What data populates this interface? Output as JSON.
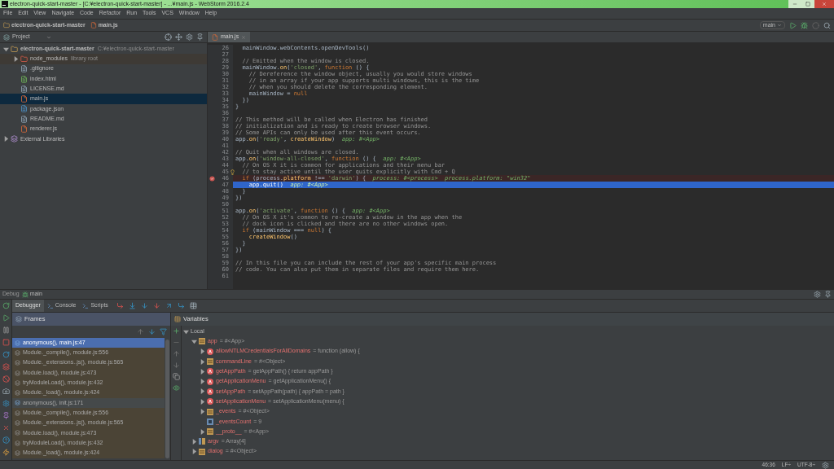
{
  "window": {
    "title": "electron-quick-start-master - [C:¥electron-quick-start-master] - ...¥main.js - WebStorm 2016.2.4"
  },
  "menu": [
    "File",
    "Edit",
    "View",
    "Navigate",
    "Code",
    "Refactor",
    "Run",
    "Tools",
    "VCS",
    "Window",
    "Help"
  ],
  "breadcrumbs": [
    "electron-quick-start-master",
    "main.js"
  ],
  "run_config": "main",
  "project": {
    "title": "Project",
    "tree": [
      {
        "name": "electron-quick-start-master",
        "hint": "C:¥electron-quick-start-master",
        "kind": "folder",
        "expanded": true,
        "selected": false,
        "children": [
          {
            "name": "node_modules",
            "hint": "library root",
            "kind": "library",
            "expanded": false,
            "selected": false
          },
          {
            "name": ".gitignore",
            "kind": "text",
            "selected": false
          },
          {
            "name": "index.html",
            "kind": "html",
            "selected": false
          },
          {
            "name": "LICENSE.md",
            "kind": "text",
            "selected": false
          },
          {
            "name": "main.js",
            "kind": "js",
            "selected": true
          },
          {
            "name": "package.json",
            "kind": "json",
            "selected": false
          },
          {
            "name": "README.md",
            "kind": "text",
            "selected": false
          },
          {
            "name": "renderer.js",
            "kind": "js",
            "selected": false
          }
        ]
      },
      {
        "name": "External Libraries",
        "kind": "external",
        "expanded": false,
        "selected": false
      }
    ]
  },
  "editor": {
    "tabs": [
      {
        "label": "main.js",
        "selected": true
      }
    ],
    "lines": [
      {
        "number": "26",
        "kind": "plain",
        "tokens": [
          {
            "text": "  mainWindow.webContents.openDevTools()",
            "kind": "plain"
          }
        ]
      },
      {
        "number": "27",
        "kind": "plain"
      },
      {
        "number": "28",
        "kind": "plain",
        "tokens": [
          {
            "text": "  // Emitted when the window is closed.",
            "kind": "comment"
          }
        ]
      },
      {
        "number": "29",
        "kind": "plain",
        "tokens": [
          {
            "text": "  mainWindow.",
            "kind": "plain"
          },
          {
            "text": "on",
            "kind": "method"
          },
          {
            "text": "(",
            "kind": "plain"
          },
          {
            "text": "'closed'",
            "kind": "string"
          },
          {
            "text": ", ",
            "kind": "plain"
          },
          {
            "text": "function",
            "kind": "keyword"
          },
          {
            "text": " () {",
            "kind": "plain"
          }
        ]
      },
      {
        "number": "30",
        "kind": "plain",
        "tokens": [
          {
            "text": "    // Dereference the window object, usually you would store windows",
            "kind": "comment"
          }
        ]
      },
      {
        "number": "31",
        "kind": "plain",
        "tokens": [
          {
            "text": "    // in an array if your app supports multi windows, this is the time",
            "kind": "comment"
          }
        ]
      },
      {
        "number": "32",
        "kind": "plain",
        "tokens": [
          {
            "text": "    // when you should delete the corresponding element.",
            "kind": "comment"
          }
        ]
      },
      {
        "number": "33",
        "kind": "plain",
        "tokens": [
          {
            "text": "    mainWindow = ",
            "kind": "plain"
          },
          {
            "text": "null",
            "kind": "keyword"
          }
        ]
      },
      {
        "number": "34",
        "kind": "plain",
        "tokens": [
          {
            "text": "  })",
            "kind": "plain"
          }
        ]
      },
      {
        "number": "35",
        "kind": "plain",
        "tokens": [
          {
            "text": "}",
            "kind": "plain"
          }
        ]
      },
      {
        "number": "36",
        "kind": "plain"
      },
      {
        "number": "37",
        "kind": "plain",
        "tokens": [
          {
            "text": "// This method will be called when Electron has finished",
            "kind": "comment"
          }
        ]
      },
      {
        "number": "38",
        "kind": "plain",
        "tokens": [
          {
            "text": "// initialization and is ready to create browser windows.",
            "kind": "comment"
          }
        ]
      },
      {
        "number": "39",
        "kind": "plain",
        "tokens": [
          {
            "text": "// Some APIs can only be used after this event occurs.",
            "kind": "comment"
          }
        ]
      },
      {
        "number": "40",
        "kind": "plain",
        "tokens": [
          {
            "text": "app.",
            "kind": "plain"
          },
          {
            "text": "on",
            "kind": "method"
          },
          {
            "text": "(",
            "kind": "plain"
          },
          {
            "text": "'ready'",
            "kind": "string"
          },
          {
            "text": ", ",
            "kind": "plain"
          },
          {
            "text": "createWindow",
            "kind": "method"
          },
          {
            "text": ")",
            "kind": "plain"
          },
          {
            "text": "  app: #<App>",
            "kind": "hint"
          }
        ]
      },
      {
        "number": "41",
        "kind": "plain"
      },
      {
        "number": "42",
        "kind": "plain",
        "tokens": [
          {
            "text": "// Quit when all windows are closed.",
            "kind": "comment"
          }
        ]
      },
      {
        "number": "43",
        "kind": "plain",
        "tokens": [
          {
            "text": "app.",
            "kind": "plain"
          },
          {
            "text": "on",
            "kind": "method"
          },
          {
            "text": "(",
            "kind": "plain"
          },
          {
            "text": "'window-all-closed'",
            "kind": "string"
          },
          {
            "text": ", ",
            "kind": "plain"
          },
          {
            "text": "function",
            "kind": "keyword"
          },
          {
            "text": " () {",
            "kind": "plain"
          },
          {
            "text": "  app: #<App>",
            "kind": "hint"
          }
        ]
      },
      {
        "number": "44",
        "kind": "plain",
        "tokens": [
          {
            "text": "  // On OS X it is common for applications and their menu bar",
            "kind": "comment"
          }
        ]
      },
      {
        "number": "45",
        "kind": "bulb",
        "tokens": [
          {
            "text": "  // to stay active until the user quits explicitly with Cmd + Q",
            "kind": "comment"
          }
        ]
      },
      {
        "number": "46",
        "kind": "breakpoint",
        "tokens": [
          {
            "text": "  if",
            "kind": "keyword"
          },
          {
            "text": " (process.",
            "kind": "plain"
          },
          {
            "text": "platform",
            "kind": "method"
          },
          {
            "text": " !== ",
            "kind": "plain"
          },
          {
            "text": "'darwin'",
            "kind": "string"
          },
          {
            "text": ") {",
            "kind": "plain"
          },
          {
            "text": "  process: #<process>  process.platform: \"win32\"",
            "kind": "hint"
          }
        ]
      },
      {
        "number": "47",
        "kind": "current",
        "tokens": [
          {
            "text": "    app.quit()",
            "kind": "plain"
          },
          {
            "text": "  app: #<App>",
            "kind": "hint"
          }
        ]
      },
      {
        "number": "48",
        "kind": "plain",
        "tokens": [
          {
            "text": "  }",
            "kind": "plain"
          }
        ]
      },
      {
        "number": "49",
        "kind": "plain",
        "tokens": [
          {
            "text": "})",
            "kind": "plain"
          }
        ]
      },
      {
        "number": "50",
        "kind": "plain"
      },
      {
        "number": "51",
        "kind": "plain",
        "tokens": [
          {
            "text": "app.",
            "kind": "plain"
          },
          {
            "text": "on",
            "kind": "method"
          },
          {
            "text": "(",
            "kind": "plain"
          },
          {
            "text": "'activate'",
            "kind": "string"
          },
          {
            "text": ", ",
            "kind": "plain"
          },
          {
            "text": "function",
            "kind": "keyword"
          },
          {
            "text": " () {",
            "kind": "plain"
          },
          {
            "text": "  app: #<App>",
            "kind": "hint"
          }
        ]
      },
      {
        "number": "52",
        "kind": "plain",
        "tokens": [
          {
            "text": "  // On OS X it's common to re-create a window in the app when the",
            "kind": "comment"
          }
        ]
      },
      {
        "number": "53",
        "kind": "plain",
        "tokens": [
          {
            "text": "  // dock icon is clicked and there are no other windows open.",
            "kind": "comment"
          }
        ]
      },
      {
        "number": "54",
        "kind": "plain",
        "tokens": [
          {
            "text": "  if",
            "kind": "keyword"
          },
          {
            "text": " (mainWindow === ",
            "kind": "plain"
          },
          {
            "text": "null",
            "kind": "keyword"
          },
          {
            "text": ") {",
            "kind": "plain"
          }
        ]
      },
      {
        "number": "55",
        "kind": "plain",
        "tokens": [
          {
            "text": "    createWindow",
            "kind": "method"
          },
          {
            "text": "()",
            "kind": "plain"
          }
        ]
      },
      {
        "number": "56",
        "kind": "plain",
        "tokens": [
          {
            "text": "  }",
            "kind": "plain"
          }
        ]
      },
      {
        "number": "57",
        "kind": "plain",
        "tokens": [
          {
            "text": "})",
            "kind": "plain"
          }
        ]
      },
      {
        "number": "58",
        "kind": "plain"
      },
      {
        "number": "59",
        "kind": "plain",
        "tokens": [
          {
            "text": "// In this file you can include the rest of your app's specific main process",
            "kind": "comment"
          }
        ]
      },
      {
        "number": "60",
        "kind": "plain",
        "tokens": [
          {
            "text": "// code. You can also put them in separate files and require them here.",
            "kind": "comment"
          }
        ]
      },
      {
        "number": "61",
        "kind": "plain"
      }
    ]
  },
  "debug": {
    "label": "Debug",
    "config": "main",
    "tabs": [
      {
        "label": "Debugger",
        "selected": true
      },
      {
        "label": "Console",
        "selected": false
      },
      {
        "label": "Scripts",
        "selected": false
      }
    ],
    "frames": {
      "title": "Frames",
      "rows": [
        {
          "label": "anonymous(), main.js:47",
          "selected": true,
          "library": false
        },
        {
          "label": "Module._compile(), module.js:556",
          "selected": false,
          "library": true
        },
        {
          "label": "Module._extensions..js(), module.js:565",
          "selected": false,
          "library": true
        },
        {
          "label": "Module.load(), module.js:473",
          "selected": false,
          "library": true
        },
        {
          "label": "tryModuleLoad(), module.js:432",
          "selected": false,
          "library": true
        },
        {
          "label": "Module._load(), module.js:424",
          "selected": false,
          "library": true
        },
        {
          "label": "anonymous(), init.js:171",
          "selected": false,
          "library": false
        },
        {
          "label": "Module._compile(), module.js:556",
          "selected": false,
          "library": true
        },
        {
          "label": "Module._extensions..js(), module.js:565",
          "selected": false,
          "library": true
        },
        {
          "label": "Module.load(), module.js:473",
          "selected": false,
          "library": true
        },
        {
          "label": "tryModuleLoad(), module.js:432",
          "selected": false,
          "library": true
        },
        {
          "label": "Module._load(), module.js:424",
          "selected": false,
          "library": true
        }
      ]
    },
    "variables": {
      "title": "Variables",
      "tree": [
        {
          "name": "Local",
          "kind": "scope",
          "expanded": true,
          "children": [
            {
              "name": "app",
              "value": "= #<App>",
              "kind": "object",
              "expanded": true,
              "children": [
                {
                  "name": "allowNTLMCredentialsForAllDomains",
                  "value": "= function (allow) {",
                  "kind": "function",
                  "expanded": false
                },
                {
                  "name": "commandLine",
                  "value": "= #<Object>",
                  "kind": "object",
                  "expanded": false
                },
                {
                  "name": "getAppPath",
                  "value": "= getAppPath() { return appPath }",
                  "kind": "function",
                  "expanded": false
                },
                {
                  "name": "getApplicationMenu",
                  "value": "= getApplicationMenu() {",
                  "kind": "function",
                  "expanded": false
                },
                {
                  "name": "setAppPath",
                  "value": "= setAppPath(path) { appPath = path }",
                  "kind": "function",
                  "expanded": false
                },
                {
                  "name": "setApplicationMenu",
                  "value": "= setApplicationMenu(menu) {",
                  "kind": "function",
                  "expanded": false
                },
                {
                  "name": "_events",
                  "value": "= #<Object>",
                  "kind": "object",
                  "expanded": false
                },
                {
                  "name": "_eventsCount",
                  "value": "= 9",
                  "kind": "number"
                },
                {
                  "name": "__proto__",
                  "value": "= #<App>",
                  "kind": "object",
                  "expanded": false
                }
              ]
            },
            {
              "name": "argv",
              "value": "= Array[4]",
              "kind": "array",
              "expanded": false
            },
            {
              "name": "dialog",
              "value": "= #<Object>",
              "kind": "object",
              "expanded": false
            }
          ]
        }
      ]
    }
  },
  "status_bar": {
    "position": "46:36",
    "line_separator": "LF÷",
    "encoding": "UTF-8÷"
  }
}
